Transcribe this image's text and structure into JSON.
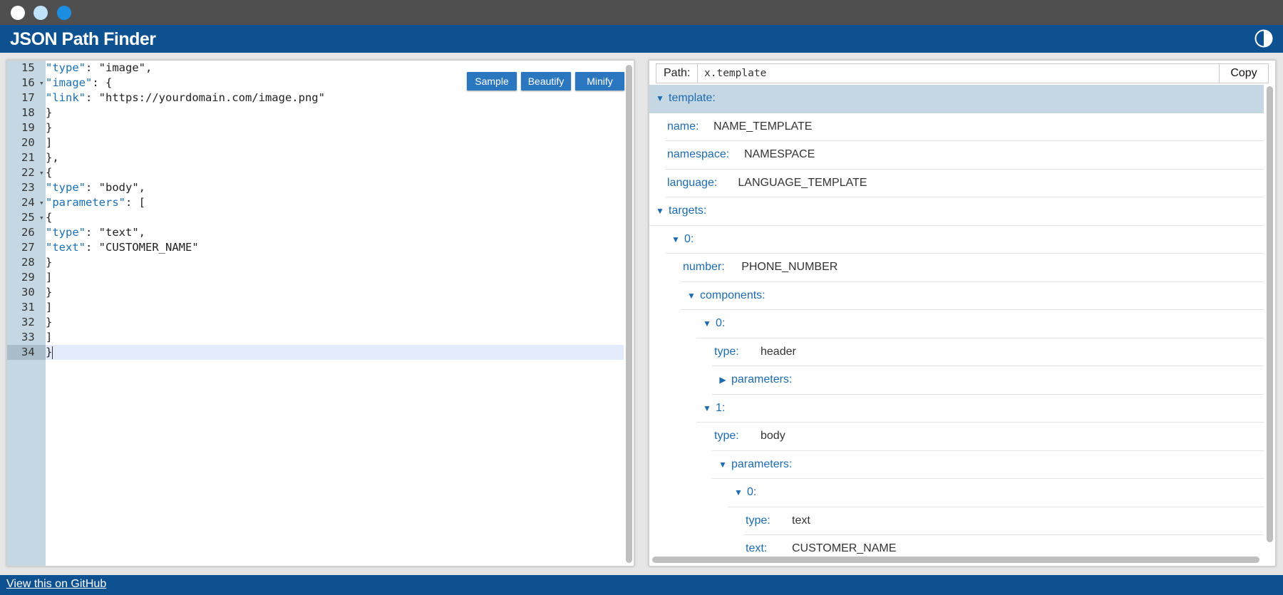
{
  "app": {
    "title": "JSON Path Finder"
  },
  "editor": {
    "buttons": {
      "sample": "Sample",
      "beautify": "Beautify",
      "minify": "Minify"
    },
    "lines": [
      {
        "n": "15",
        "fold": false,
        "tokens": [
          [
            "key",
            "\"type\""
          ],
          [
            "p",
            ": "
          ],
          [
            "str",
            "\"image\""
          ],
          [
            "p",
            ","
          ]
        ]
      },
      {
        "n": "16",
        "fold": true,
        "tokens": [
          [
            "key",
            "\"image\""
          ],
          [
            "p",
            ": {"
          ]
        ]
      },
      {
        "n": "17",
        "fold": false,
        "tokens": [
          [
            "key",
            "\"link\""
          ],
          [
            "p",
            ": "
          ],
          [
            "str",
            "\"https://yourdomain.com/image.png\""
          ]
        ]
      },
      {
        "n": "18",
        "fold": false,
        "tokens": [
          [
            "p",
            "}"
          ]
        ]
      },
      {
        "n": "19",
        "fold": false,
        "tokens": [
          [
            "p",
            "}"
          ]
        ]
      },
      {
        "n": "20",
        "fold": false,
        "tokens": [
          [
            "p",
            "]"
          ]
        ]
      },
      {
        "n": "21",
        "fold": false,
        "tokens": [
          [
            "p",
            "},"
          ]
        ]
      },
      {
        "n": "22",
        "fold": true,
        "tokens": [
          [
            "p",
            "{"
          ]
        ]
      },
      {
        "n": "23",
        "fold": false,
        "tokens": [
          [
            "key",
            "\"type\""
          ],
          [
            "p",
            ": "
          ],
          [
            "str",
            "\"body\""
          ],
          [
            "p",
            ","
          ]
        ]
      },
      {
        "n": "24",
        "fold": true,
        "tokens": [
          [
            "key",
            "\"parameters\""
          ],
          [
            "p",
            ": ["
          ]
        ]
      },
      {
        "n": "25",
        "fold": true,
        "tokens": [
          [
            "p",
            "{"
          ]
        ]
      },
      {
        "n": "26",
        "fold": false,
        "tokens": [
          [
            "key",
            "\"type\""
          ],
          [
            "p",
            ": "
          ],
          [
            "str",
            "\"text\""
          ],
          [
            "p",
            ","
          ]
        ]
      },
      {
        "n": "27",
        "fold": false,
        "tokens": [
          [
            "key",
            "\"text\""
          ],
          [
            "p",
            ": "
          ],
          [
            "str",
            "\"CUSTOMER_NAME\""
          ]
        ]
      },
      {
        "n": "28",
        "fold": false,
        "tokens": [
          [
            "p",
            "}"
          ]
        ]
      },
      {
        "n": "29",
        "fold": false,
        "tokens": [
          [
            "p",
            "]"
          ]
        ]
      },
      {
        "n": "30",
        "fold": false,
        "tokens": [
          [
            "p",
            "}"
          ]
        ]
      },
      {
        "n": "31",
        "fold": false,
        "tokens": [
          [
            "p",
            "]"
          ]
        ]
      },
      {
        "n": "32",
        "fold": false,
        "tokens": [
          [
            "p",
            "}"
          ]
        ]
      },
      {
        "n": "33",
        "fold": false,
        "tokens": [
          [
            "p",
            "]"
          ]
        ]
      },
      {
        "n": "34",
        "fold": false,
        "active": true,
        "tokens": [
          [
            "p",
            "}"
          ]
        ]
      }
    ]
  },
  "viewer": {
    "path_label": "Path:",
    "path_value": "x.template",
    "copy_label": "Copy",
    "tree": [
      {
        "depth": 0,
        "toggle": "open",
        "key": "template:",
        "value": "",
        "selected": true
      },
      {
        "depth": 1,
        "toggle": "none",
        "key": "name:",
        "value": "NAME_TEMPLATE"
      },
      {
        "depth": 1,
        "toggle": "none",
        "key": "namespace:",
        "value": "NAMESPACE"
      },
      {
        "depth": 1,
        "toggle": "none",
        "key": "language:",
        "value": "LANGUAGE_TEMPLATE"
      },
      {
        "depth": 0,
        "toggle": "open",
        "key": "targets:",
        "value": ""
      },
      {
        "depth": 1,
        "toggle": "open",
        "key": "0:",
        "value": ""
      },
      {
        "depth": 2,
        "toggle": "none",
        "key": "number:",
        "value": "PHONE_NUMBER"
      },
      {
        "depth": 2,
        "toggle": "open",
        "key": "components:",
        "value": ""
      },
      {
        "depth": 3,
        "toggle": "open",
        "key": "0:",
        "value": ""
      },
      {
        "depth": 4,
        "toggle": "none",
        "key": "type:",
        "value": "header"
      },
      {
        "depth": 4,
        "toggle": "closed",
        "key": "parameters:",
        "value": ""
      },
      {
        "depth": 3,
        "toggle": "open",
        "key": "1:",
        "value": ""
      },
      {
        "depth": 4,
        "toggle": "none",
        "key": "type:",
        "value": "body"
      },
      {
        "depth": 4,
        "toggle": "open",
        "key": "parameters:",
        "value": ""
      },
      {
        "depth": 5,
        "toggle": "open",
        "key": "0:",
        "value": ""
      },
      {
        "depth": 6,
        "toggle": "none",
        "key": "type:",
        "value": "text"
      },
      {
        "depth": 6,
        "toggle": "none",
        "key": "text:",
        "value": "CUSTOMER_NAME"
      }
    ]
  },
  "footer": {
    "link": "View this on GitHub"
  }
}
